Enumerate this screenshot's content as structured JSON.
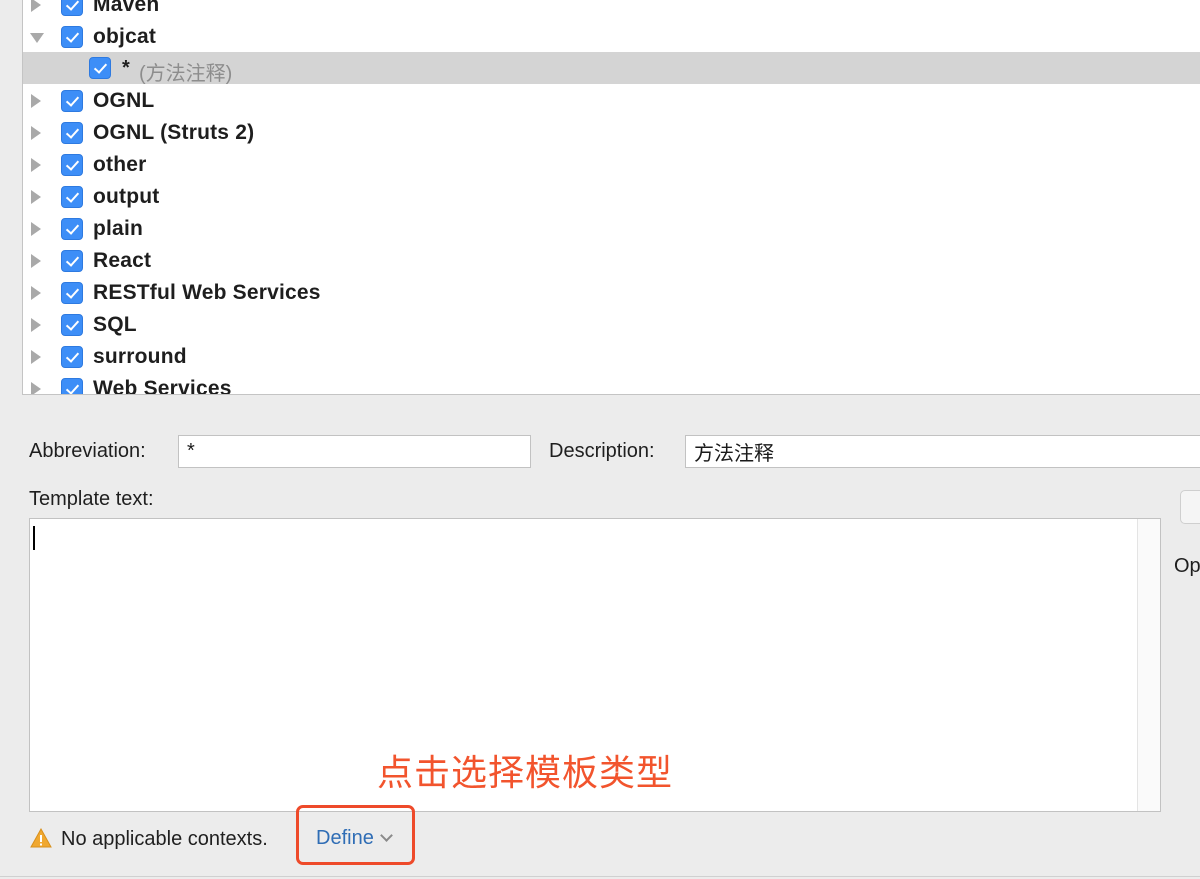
{
  "tree": {
    "groups": [
      {
        "label": "Maven",
        "expanded": false,
        "checked": true
      },
      {
        "label": "objcat",
        "expanded": true,
        "checked": true
      },
      {
        "label": "OGNL",
        "expanded": false,
        "checked": true
      },
      {
        "label": "OGNL (Struts 2)",
        "expanded": false,
        "checked": true
      },
      {
        "label": "other",
        "expanded": false,
        "checked": true
      },
      {
        "label": "output",
        "expanded": false,
        "checked": true
      },
      {
        "label": "plain",
        "expanded": false,
        "checked": true
      },
      {
        "label": "React",
        "expanded": false,
        "checked": true
      },
      {
        "label": "RESTful Web Services",
        "expanded": false,
        "checked": true
      },
      {
        "label": "SQL",
        "expanded": false,
        "checked": true
      },
      {
        "label": "surround",
        "expanded": false,
        "checked": true
      },
      {
        "label": "Web Services",
        "expanded": false,
        "checked": true
      }
    ],
    "selected_item": {
      "abbreviation": "*",
      "description": "(方法注释)",
      "checked": true
    }
  },
  "form": {
    "abbreviation_label": "Abbreviation:",
    "abbreviation_value": "*",
    "description_label": "Description:",
    "description_value": "方法注释",
    "template_label": "Template text:",
    "template_value": ""
  },
  "options_label_partial": "Op",
  "status": {
    "warning_text": "No applicable contexts.",
    "define_label": "Define"
  },
  "annotation": {
    "text": "点击选择模板类型",
    "color": "#f2542d"
  },
  "colors": {
    "checkbox": "#3d8ef7",
    "link": "#2f6db5",
    "selection": "#d4d4d4",
    "highlight_box": "#ee4a2a"
  }
}
